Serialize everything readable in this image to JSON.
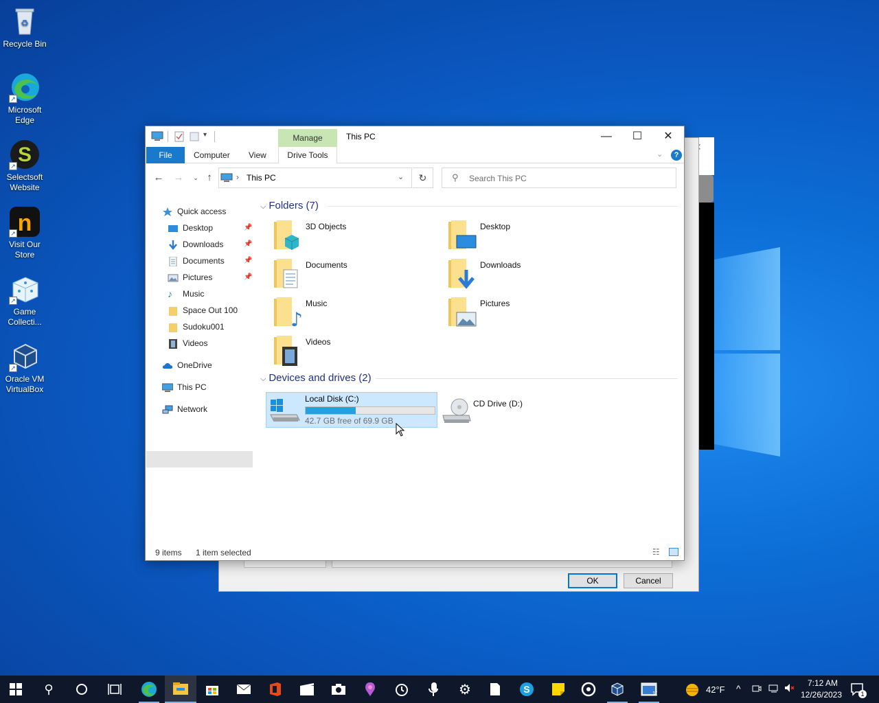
{
  "desktop": {
    "icons": [
      {
        "label": "Recycle Bin"
      },
      {
        "label": "Microsoft Edge"
      },
      {
        "label": "Selectsoft Website"
      },
      {
        "label": "Visit Our Store"
      },
      {
        "label": "Game Collecti..."
      },
      {
        "label": "Oracle VM VirtualBox"
      }
    ]
  },
  "background_dialog": {
    "ok_label": "OK",
    "cancel_label": "Cancel"
  },
  "explorer": {
    "title": "This PC",
    "manage_tab": "Manage",
    "ribbon_tabs": {
      "file": "File",
      "computer": "Computer",
      "view": "View",
      "drive_tools": "Drive Tools"
    },
    "address": {
      "path": "This PC"
    },
    "search": {
      "placeholder": "Search This PC"
    },
    "nav": {
      "quick_access": "Quick access",
      "desktop": "Desktop",
      "downloads": "Downloads",
      "documents": "Documents",
      "pictures": "Pictures",
      "music": "Music",
      "space_out": "Space Out 100",
      "sudoku": "Sudoku001",
      "videos": "Videos",
      "onedrive": "OneDrive",
      "this_pc": "This PC",
      "network": "Network"
    },
    "folders_header": "Folders (7)",
    "folders": {
      "objects3d": "3D Objects",
      "desktop": "Desktop",
      "documents": "Documents",
      "downloads": "Downloads",
      "music": "Music",
      "pictures": "Pictures",
      "videos": "Videos"
    },
    "devices_header": "Devices and drives (2)",
    "drives": {
      "c_label": "Local Disk (C:)",
      "c_free": "42.7 GB free of 69.9 GB",
      "c_used_fraction": 0.39,
      "d_label": "CD Drive (D:)"
    },
    "status": {
      "items": "9 items",
      "selected": "1 item selected"
    }
  },
  "taskbar": {
    "weather": "42°F",
    "time": "7:12 AM",
    "date": "12/26/2023",
    "notifications_count": "1"
  },
  "colors": {
    "accent": "#0078d7",
    "selection": "#cce8ff",
    "drive_bar": "#26a0da",
    "manage_tab": "#c8e6b4"
  }
}
